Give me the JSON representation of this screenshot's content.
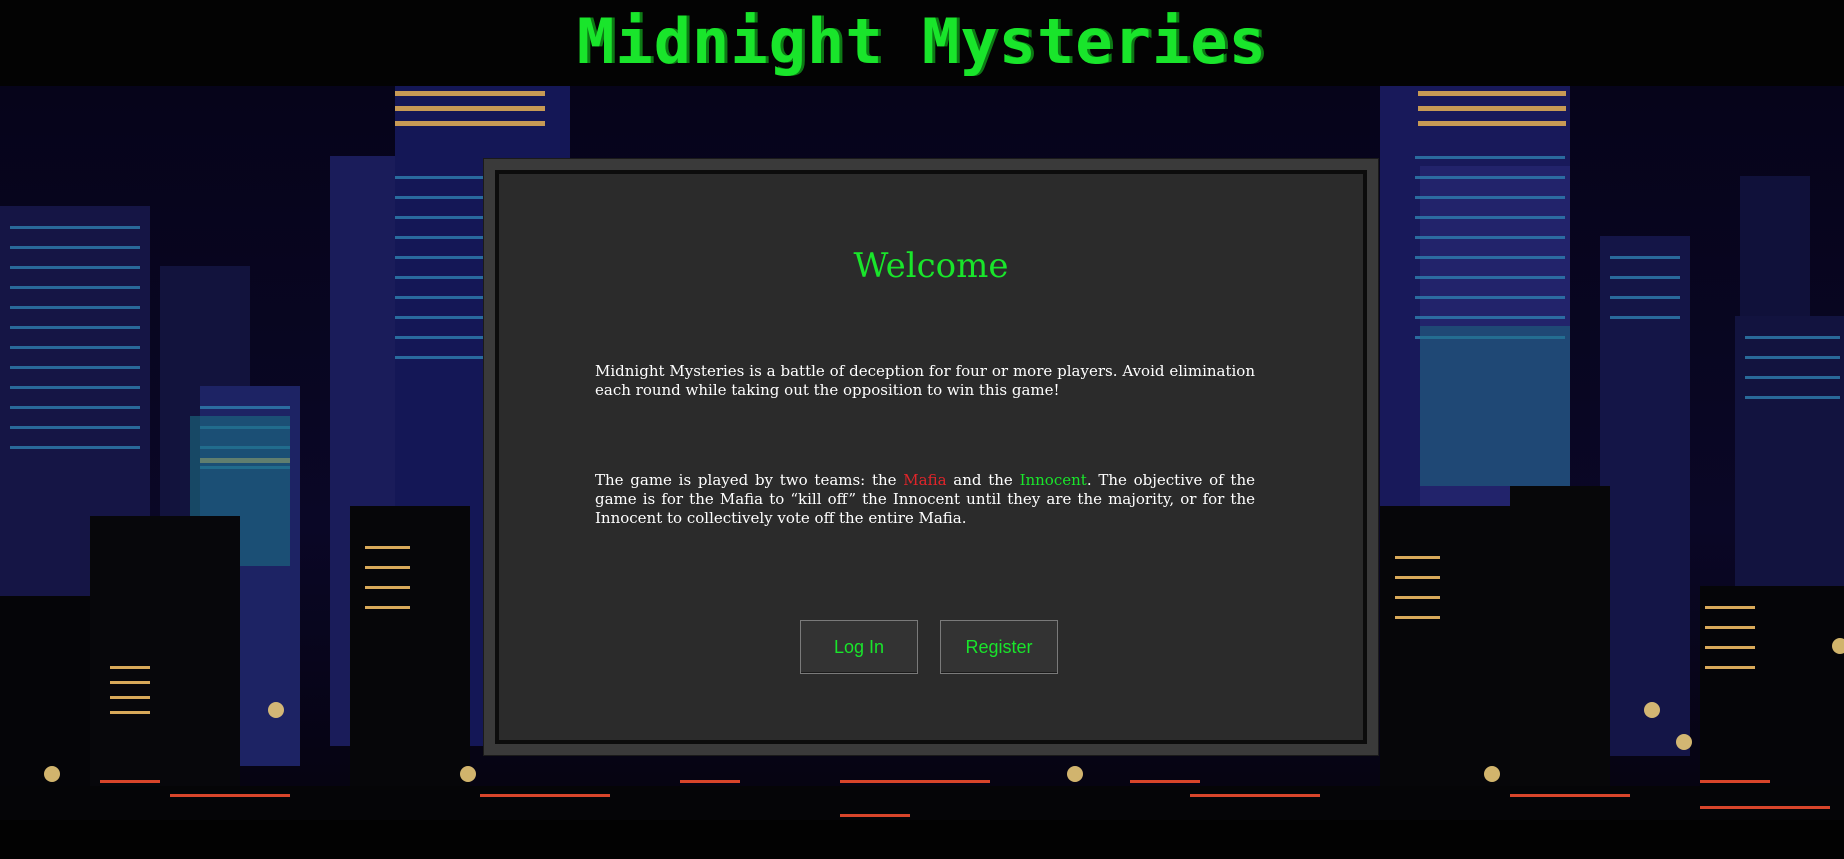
{
  "header": {
    "title": "Midnight Mysteries"
  },
  "panel": {
    "heading": "Welcome",
    "intro": "Midnight Mysteries is a battle of deception for four or more players. Avoid elimination each round while taking out the opposition to win this game!",
    "teams": {
      "before": "The game is played by two teams: the ",
      "mafia": "Mafia",
      "between": " and the ",
      "innocent": "Innocent",
      "after": ". The objective of the game is for the Mafia to “kill off” the Innocent until they are the majority, or for the Innocent to collectively vote off the entire Mafia."
    }
  },
  "buttons": {
    "login": "Log In",
    "register": "Register"
  },
  "colors": {
    "accent_green": "#19e52b",
    "mafia_red": "#e0252a",
    "panel_bg": "#2b2b2b"
  }
}
